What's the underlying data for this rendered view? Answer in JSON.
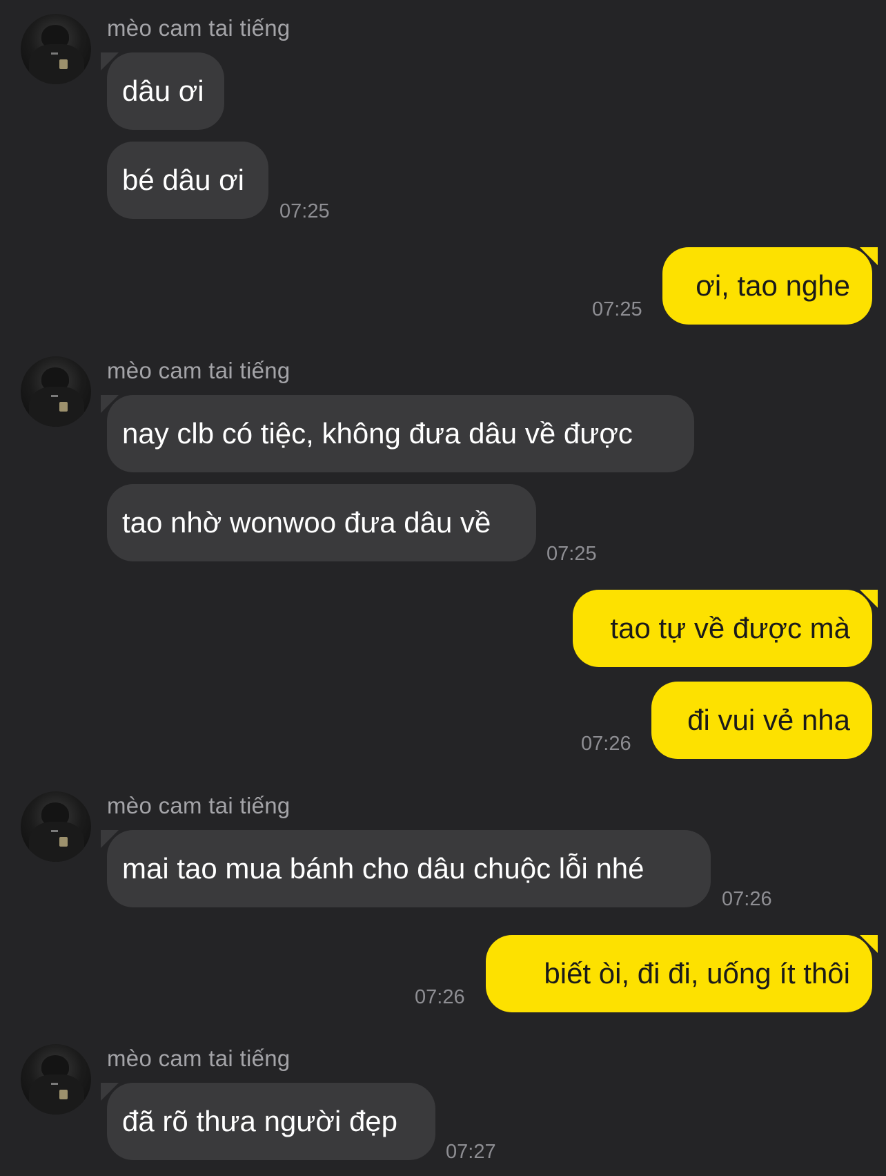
{
  "contact": {
    "name": "mèo cam tai tiếng",
    "avatar_icon": "profile-photo-avatar"
  },
  "colors": {
    "background": "#242426",
    "incoming_bubble": "#3a3a3c",
    "outgoing_bubble": "#fde100",
    "timestamp": "#8e8e93"
  },
  "messages": [
    {
      "sender": "contact",
      "text": "dâu ơi"
    },
    {
      "sender": "contact",
      "text": "bé dâu ơi",
      "time": "07:25"
    },
    {
      "sender": "me",
      "text": "ơi, tao nghe",
      "time": "07:25"
    },
    {
      "sender": "contact",
      "text": "nay clb có tiệc, không đưa dâu về được"
    },
    {
      "sender": "contact",
      "text": "tao nhờ wonwoo đưa dâu về",
      "time": "07:25"
    },
    {
      "sender": "me",
      "text": "tao tự về được mà"
    },
    {
      "sender": "me",
      "text": "đi vui vẻ nha",
      "time": "07:26"
    },
    {
      "sender": "contact",
      "text": "mai tao mua bánh cho dâu chuộc lỗi nhé",
      "time": "07:26"
    },
    {
      "sender": "me",
      "text": "biết òi, đi đi, uống ít thôi",
      "time": "07:26"
    },
    {
      "sender": "contact",
      "text": "đã rõ thưa người đẹp",
      "time": "07:27"
    }
  ]
}
